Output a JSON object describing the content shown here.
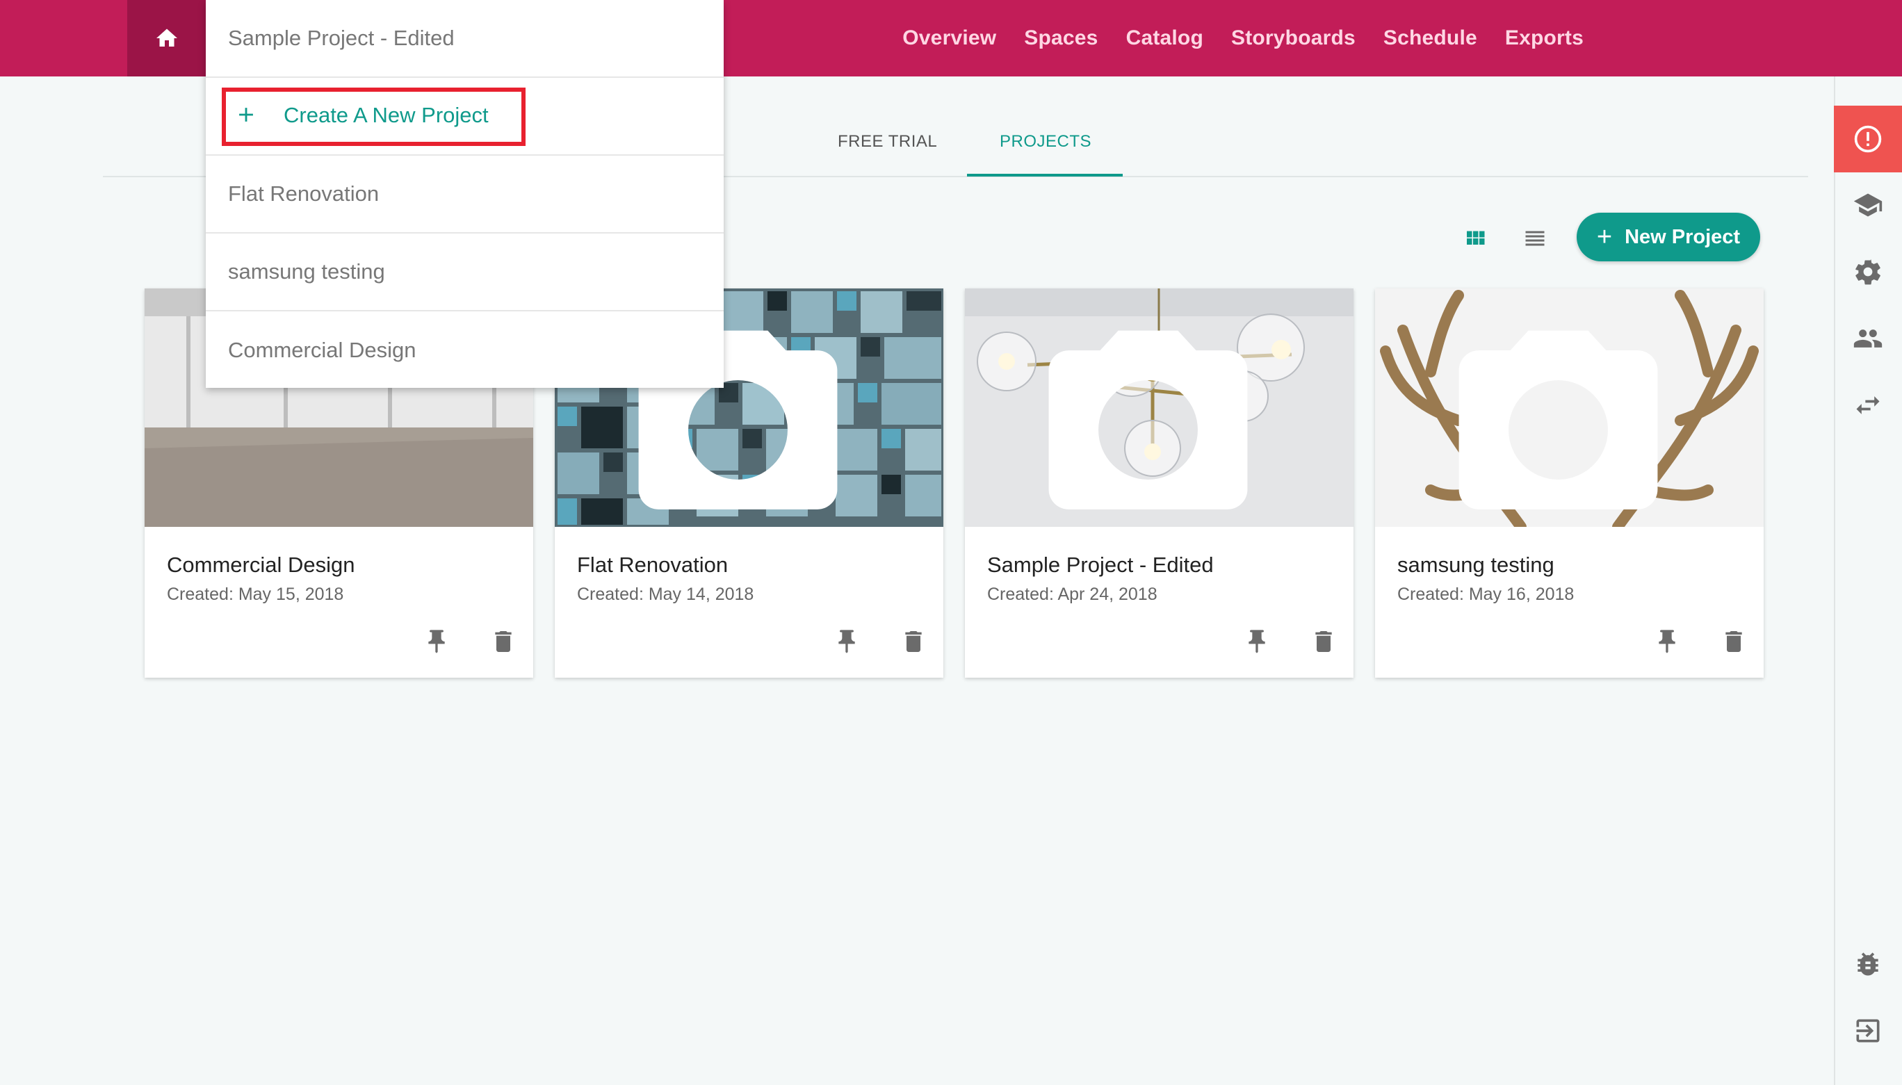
{
  "topbar": {
    "home_icon": "home-icon",
    "nav": [
      "Overview",
      "Spaces",
      "Catalog",
      "Storyboards",
      "Schedule",
      "Exports"
    ],
    "brand_color": "#c21d58"
  },
  "dropdown": {
    "current": "Sample Project - Edited",
    "create_label": "Create A New Project",
    "projects": [
      "Flat Renovation",
      "samsung testing",
      "Commercial Design"
    ]
  },
  "tabs": {
    "free_trial": "FREE TRIAL",
    "projects": "PROJECTS",
    "active": "PROJECTS"
  },
  "toolbar": {
    "new_project_label": "New Project",
    "accent_color": "#0f9a8b"
  },
  "cards": [
    {
      "title": "Commercial Design",
      "date": "Created: May 15, 2018",
      "image": "empty-room-photo"
    },
    {
      "title": "Flat Renovation",
      "date": "Created: May 14, 2018",
      "image": "blue-tiles-photo"
    },
    {
      "title": "Sample Project - Edited",
      "date": "Created: Apr 24, 2018",
      "image": "chandelier-photo"
    },
    {
      "title": "samsung testing",
      "date": "Created: May 16, 2018",
      "image": "antlers-photo"
    }
  ],
  "sidebar_icons": [
    "alert-icon",
    "graduation-cap-icon",
    "gear-icon",
    "people-icon",
    "swap-icon",
    "bug-icon",
    "logout-icon"
  ]
}
